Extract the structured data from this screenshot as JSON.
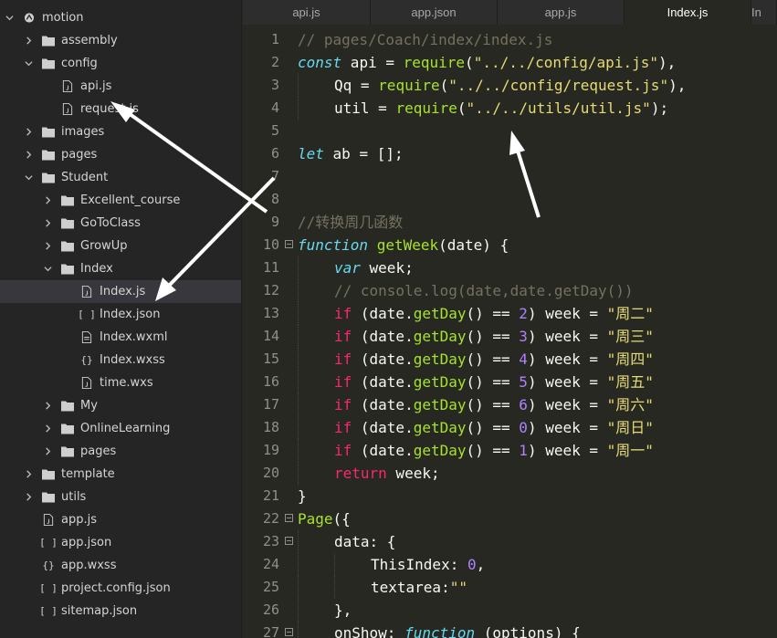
{
  "tree": [
    {
      "label": "motion",
      "type": "root",
      "depth": 0,
      "expanded": true
    },
    {
      "label": "assembly",
      "type": "folder",
      "depth": 1,
      "expanded": false
    },
    {
      "label": "config",
      "type": "folder",
      "depth": 1,
      "expanded": true
    },
    {
      "label": "api.js",
      "type": "js",
      "depth": 2
    },
    {
      "label": "request.js",
      "type": "js",
      "depth": 2
    },
    {
      "label": "images",
      "type": "folder",
      "depth": 1,
      "expanded": false
    },
    {
      "label": "pages",
      "type": "folder",
      "depth": 1,
      "expanded": false
    },
    {
      "label": "Student",
      "type": "folder",
      "depth": 1,
      "expanded": true
    },
    {
      "label": "Excellent_course",
      "type": "folder",
      "depth": 2,
      "expanded": false
    },
    {
      "label": "GoToClass",
      "type": "folder",
      "depth": 2,
      "expanded": false
    },
    {
      "label": "GrowUp",
      "type": "folder",
      "depth": 2,
      "expanded": false
    },
    {
      "label": "Index",
      "type": "folder",
      "depth": 2,
      "expanded": true
    },
    {
      "label": "Index.js",
      "type": "js",
      "depth": 3,
      "selected": true
    },
    {
      "label": "Index.json",
      "type": "json",
      "depth": 3
    },
    {
      "label": "Index.wxml",
      "type": "file",
      "depth": 3
    },
    {
      "label": "Index.wxss",
      "type": "css",
      "depth": 3
    },
    {
      "label": "time.wxs",
      "type": "js",
      "depth": 3
    },
    {
      "label": "My",
      "type": "folder",
      "depth": 2,
      "expanded": false
    },
    {
      "label": "OnlineLearning",
      "type": "folder",
      "depth": 2,
      "expanded": false
    },
    {
      "label": "pages",
      "type": "folder",
      "depth": 2,
      "expanded": false
    },
    {
      "label": "template",
      "type": "folder",
      "depth": 1,
      "expanded": false
    },
    {
      "label": "utils",
      "type": "folder",
      "depth": 1,
      "expanded": false
    },
    {
      "label": "app.js",
      "type": "js",
      "depth": 1
    },
    {
      "label": "app.json",
      "type": "json",
      "depth": 1
    },
    {
      "label": "app.wxss",
      "type": "css",
      "depth": 1
    },
    {
      "label": "project.config.json",
      "type": "json",
      "depth": 1
    },
    {
      "label": "sitemap.json",
      "type": "json",
      "depth": 1
    }
  ],
  "tabs": [
    {
      "label": "api.js"
    },
    {
      "label": "app.json"
    },
    {
      "label": "app.js"
    },
    {
      "label": "Index.js",
      "active": true
    },
    {
      "label": "In"
    }
  ],
  "code": [
    {
      "n": "1",
      "indent": 0,
      "tokens": [
        {
          "t": "// pages/Coach/index/index.js",
          "c": "comment"
        }
      ]
    },
    {
      "n": "2",
      "indent": 0,
      "tokens": [
        {
          "t": "const",
          "c": "storage"
        },
        {
          "t": " api = ",
          "c": "plain"
        },
        {
          "t": "require",
          "c": "fn"
        },
        {
          "t": "(",
          "c": "plain"
        },
        {
          "t": "\"../../config/api.js\"",
          "c": "str"
        },
        {
          "t": "),",
          "c": "plain"
        }
      ]
    },
    {
      "n": "3",
      "indent": 1,
      "tokens": [
        {
          "t": "Qq = ",
          "c": "plain"
        },
        {
          "t": "require",
          "c": "fn"
        },
        {
          "t": "(",
          "c": "plain"
        },
        {
          "t": "\"../../config/request.js\"",
          "c": "str"
        },
        {
          "t": "),",
          "c": "plain"
        }
      ]
    },
    {
      "n": "4",
      "indent": 1,
      "tokens": [
        {
          "t": "util = ",
          "c": "plain"
        },
        {
          "t": "require",
          "c": "fn"
        },
        {
          "t": "(",
          "c": "plain"
        },
        {
          "t": "\"../../utils/util.js\"",
          "c": "str"
        },
        {
          "t": ");",
          "c": "plain"
        }
      ]
    },
    {
      "n": "5",
      "indent": 0,
      "tokens": []
    },
    {
      "n": "6",
      "indent": 0,
      "tokens": [
        {
          "t": "let",
          "c": "storage"
        },
        {
          "t": " ab = [];",
          "c": "plain"
        }
      ]
    },
    {
      "n": "7",
      "indent": 0,
      "tokens": []
    },
    {
      "n": "8",
      "indent": 0,
      "tokens": []
    },
    {
      "n": "9",
      "indent": 0,
      "tokens": [
        {
          "t": "//转换周几函数",
          "c": "comment"
        }
      ]
    },
    {
      "n": "10",
      "indent": 0,
      "fold": true,
      "tokens": [
        {
          "t": "function",
          "c": "storage"
        },
        {
          "t": " ",
          "c": "plain"
        },
        {
          "t": "getWeek",
          "c": "fn"
        },
        {
          "t": "(date) {",
          "c": "plain"
        }
      ]
    },
    {
      "n": "11",
      "indent": 1,
      "tokens": [
        {
          "t": "var",
          "c": "storage"
        },
        {
          "t": " week;",
          "c": "plain"
        }
      ]
    },
    {
      "n": "12",
      "indent": 1,
      "tokens": [
        {
          "t": "// console.log(date,date.getDay())",
          "c": "comment"
        }
      ]
    },
    {
      "n": "13",
      "indent": 1,
      "tokens": [
        {
          "t": "if",
          "c": "kw"
        },
        {
          "t": " (date.",
          "c": "plain"
        },
        {
          "t": "getDay",
          "c": "fn"
        },
        {
          "t": "() == ",
          "c": "plain"
        },
        {
          "t": "2",
          "c": "num"
        },
        {
          "t": ") week = ",
          "c": "plain"
        },
        {
          "t": "\"周二\"",
          "c": "str"
        }
      ]
    },
    {
      "n": "14",
      "indent": 1,
      "tokens": [
        {
          "t": "if",
          "c": "kw"
        },
        {
          "t": " (date.",
          "c": "plain"
        },
        {
          "t": "getDay",
          "c": "fn"
        },
        {
          "t": "() == ",
          "c": "plain"
        },
        {
          "t": "3",
          "c": "num"
        },
        {
          "t": ") week = ",
          "c": "plain"
        },
        {
          "t": "\"周三\"",
          "c": "str"
        }
      ]
    },
    {
      "n": "15",
      "indent": 1,
      "tokens": [
        {
          "t": "if",
          "c": "kw"
        },
        {
          "t": " (date.",
          "c": "plain"
        },
        {
          "t": "getDay",
          "c": "fn"
        },
        {
          "t": "() == ",
          "c": "plain"
        },
        {
          "t": "4",
          "c": "num"
        },
        {
          "t": ") week = ",
          "c": "plain"
        },
        {
          "t": "\"周四\"",
          "c": "str"
        }
      ]
    },
    {
      "n": "16",
      "indent": 1,
      "tokens": [
        {
          "t": "if",
          "c": "kw"
        },
        {
          "t": " (date.",
          "c": "plain"
        },
        {
          "t": "getDay",
          "c": "fn"
        },
        {
          "t": "() == ",
          "c": "plain"
        },
        {
          "t": "5",
          "c": "num"
        },
        {
          "t": ") week = ",
          "c": "plain"
        },
        {
          "t": "\"周五\"",
          "c": "str"
        }
      ]
    },
    {
      "n": "17",
      "indent": 1,
      "tokens": [
        {
          "t": "if",
          "c": "kw"
        },
        {
          "t": " (date.",
          "c": "plain"
        },
        {
          "t": "getDay",
          "c": "fn"
        },
        {
          "t": "() == ",
          "c": "plain"
        },
        {
          "t": "6",
          "c": "num"
        },
        {
          "t": ") week = ",
          "c": "plain"
        },
        {
          "t": "\"周六\"",
          "c": "str"
        }
      ]
    },
    {
      "n": "18",
      "indent": 1,
      "tokens": [
        {
          "t": "if",
          "c": "kw"
        },
        {
          "t": " (date.",
          "c": "plain"
        },
        {
          "t": "getDay",
          "c": "fn"
        },
        {
          "t": "() == ",
          "c": "plain"
        },
        {
          "t": "0",
          "c": "num"
        },
        {
          "t": ") week = ",
          "c": "plain"
        },
        {
          "t": "\"周日\"",
          "c": "str"
        }
      ]
    },
    {
      "n": "19",
      "indent": 1,
      "tokens": [
        {
          "t": "if",
          "c": "kw"
        },
        {
          "t": " (date.",
          "c": "plain"
        },
        {
          "t": "getDay",
          "c": "fn"
        },
        {
          "t": "() == ",
          "c": "plain"
        },
        {
          "t": "1",
          "c": "num"
        },
        {
          "t": ") week = ",
          "c": "plain"
        },
        {
          "t": "\"周一\"",
          "c": "str"
        }
      ]
    },
    {
      "n": "20",
      "indent": 1,
      "tokens": [
        {
          "t": "return",
          "c": "kw"
        },
        {
          "t": " week;",
          "c": "plain"
        }
      ]
    },
    {
      "n": "21",
      "indent": 0,
      "tokens": [
        {
          "t": "}",
          "c": "plain"
        }
      ]
    },
    {
      "n": "22",
      "indent": 0,
      "fold": true,
      "tokens": [
        {
          "t": "Page",
          "c": "fn"
        },
        {
          "t": "({",
          "c": "plain"
        }
      ]
    },
    {
      "n": "23",
      "indent": 1,
      "fold": true,
      "tokens": [
        {
          "t": "data: {",
          "c": "plain"
        }
      ]
    },
    {
      "n": "24",
      "indent": 2,
      "tokens": [
        {
          "t": "ThisIndex: ",
          "c": "plain"
        },
        {
          "t": "0",
          "c": "num"
        },
        {
          "t": ",",
          "c": "plain"
        }
      ]
    },
    {
      "n": "25",
      "indent": 2,
      "tokens": [
        {
          "t": "textarea:",
          "c": "plain"
        },
        {
          "t": "\"\"",
          "c": "str"
        }
      ]
    },
    {
      "n": "26",
      "indent": 1,
      "tokens": [
        {
          "t": "},",
          "c": "plain"
        }
      ]
    },
    {
      "n": "27",
      "indent": 1,
      "fold": true,
      "tokens": [
        {
          "t": "onShow: ",
          "c": "plain"
        },
        {
          "t": "function",
          "c": "storage"
        },
        {
          "t": " (options) {",
          "c": "plain"
        }
      ]
    }
  ],
  "colors": {
    "editor_bg": "#272822",
    "sidebar_bg": "#252526",
    "comment": "#75715e",
    "storage": "#66d9ef",
    "function": "#a6e22e",
    "string": "#e6db74",
    "keyword": "#f92672",
    "number": "#ae81ff",
    "arrow": "#ffffff"
  }
}
